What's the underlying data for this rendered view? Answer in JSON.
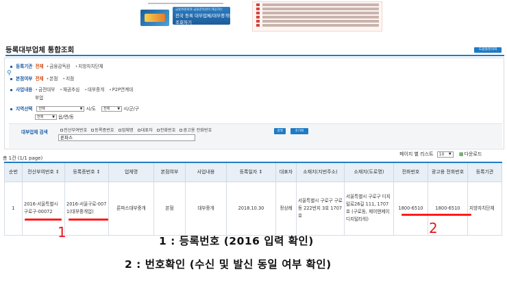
{
  "banner": {
    "headline": "금융위원회와 금융감독원이 제공하는",
    "title_line1": "전국 등록 대부업체/대부중개업체",
    "title_line2": "조회하기"
  },
  "page": {
    "title": "등록대부업체 통합조회",
    "help_button": "도움말/문의처"
  },
  "filters": {
    "registrar": {
      "label": "등록기관",
      "value": "전체",
      "options": [
        "금융감독원",
        "지방자치단체"
      ]
    },
    "branch": {
      "label": "본점여부",
      "value": "전체",
      "options": [
        "본점",
        "지점"
      ]
    },
    "business": {
      "label": "사업내용",
      "options": [
        "금전대부",
        "채권추심",
        "대부중개",
        "P2P연계대",
        "부업"
      ]
    },
    "region": {
      "label": "지역선택",
      "city_select": "전체",
      "city_unit": "시/도",
      "district_select": "전체",
      "district_unit": "시/군/구",
      "town_select": "전체",
      "town_unit": "읍/면/동"
    },
    "search": {
      "label": "대부업체 검색",
      "options": [
        "전산부여번호",
        "등록증번호",
        "업체명",
        "대표자",
        "전화번호",
        "광고용 전화번호"
      ],
      "query": "론파스",
      "search_button": "검색",
      "reset_button": "초기화"
    }
  },
  "results": {
    "count_text": "총 1건 (1/1 page)",
    "page_size_label": "페이지 별 리스트",
    "page_size_value": "10",
    "download_label": "다운로드",
    "columns": [
      "순번",
      "전산부여번호 ↕",
      "등록증번호 ↕",
      "업체명",
      "본점여부",
      "사업내용",
      "등록일자 ↕",
      "대표자",
      "소재지(지번주소)",
      "소재지(도로명)",
      "전화번호",
      "광고용 전화번호",
      "등록기관"
    ],
    "rows": [
      {
        "no": "1",
        "system_no": "2016-서울특별시 구로구-00072",
        "cert_no": "2016-서울구로-0071(대부중개업)",
        "company": "론파스대부중개",
        "branch": "본점",
        "business": "대부중개",
        "reg_date": "2018.10.30",
        "rep": "정상례",
        "address_lot": "서울특별시 구로구 구로동 222번지 3호 1707호",
        "address_road": "서울특별시 구로구 디지털로26길 111, 1707호 (구로동, 제이앤케이디지털타워)",
        "phone": "1800-6510",
        "ad_phone": "1800-6510",
        "registrar": "지방자치단체"
      }
    ]
  },
  "annotations": {
    "mark1": "1",
    "mark2": "2",
    "caption1": "1 : 등록번호 (2016 입력 확인)",
    "caption2": "2 : 번호확인 (수신 및 발신 동일 여부 확인)",
    "highlight_color": "#ff1a1a"
  }
}
